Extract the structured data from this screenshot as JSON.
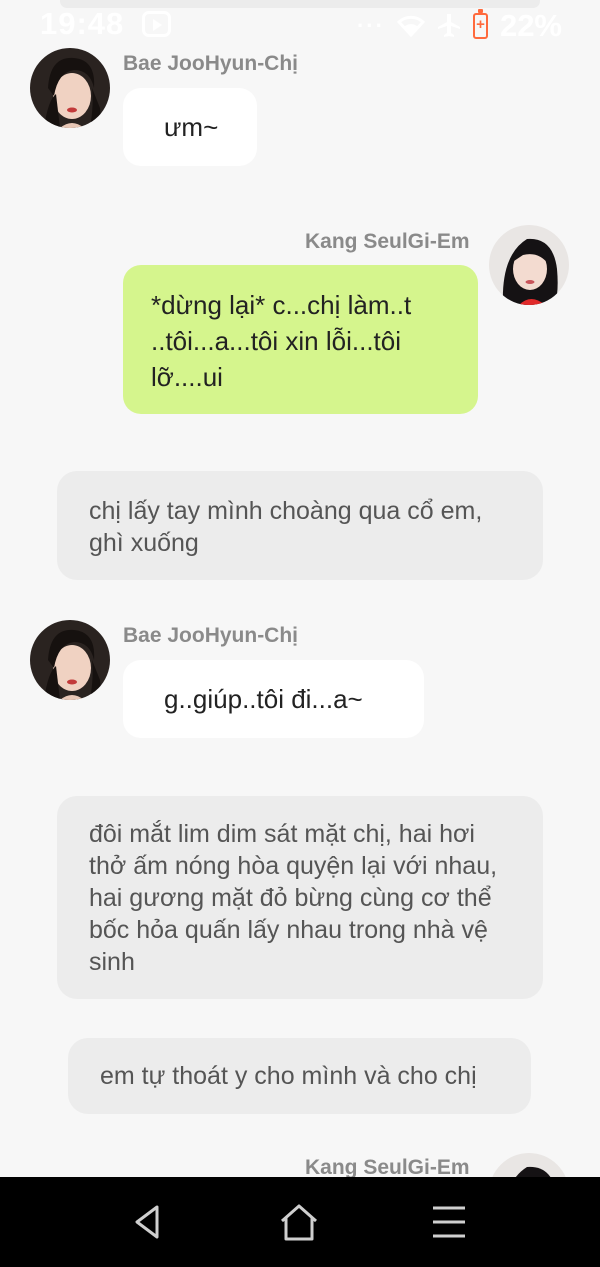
{
  "status_bar": {
    "time": "19:48",
    "battery": "22%",
    "dots": "···"
  },
  "messages": [
    {
      "type": "left",
      "sender": "Bae JooHyun-Chị",
      "text": "ưm~"
    },
    {
      "type": "right",
      "sender": "Kang SeulGi-Em",
      "text": "*dừng lại* c...chị làm..t ..tôi...a...tôi xin lỗi...tôi lỡ....ui"
    },
    {
      "type": "narration",
      "text": "chị lấy tay mình choàng qua cổ em, ghì xuống"
    },
    {
      "type": "left",
      "sender": "Bae JooHyun-Chị",
      "text": "g..giúp..tôi đi...a~"
    },
    {
      "type": "narration",
      "text": "đôi mắt lim dim sát mặt chị, hai hơi thở ấm nóng hòa quyện lại với nhau, hai gương mặt đỏ bừng cùng cơ thể bốc hỏa quấn lấy nhau trong nhà vệ sinh"
    },
    {
      "type": "narration",
      "text": "em tự thoát y cho mình và cho chị"
    },
    {
      "type": "right",
      "sender": "Kang SeulGi-Em",
      "text": ""
    }
  ],
  "colors": {
    "background": "#f7f7f7",
    "bubble_left": "#ffffff",
    "bubble_right": "#d5f58d",
    "narration": "#ececec",
    "sender_name": "#8a8a8a",
    "battery": "#ff6a3d"
  },
  "nav": {
    "back_icon": "back-triangle-icon",
    "home_icon": "home-icon",
    "menu_icon": "menu-icon"
  }
}
